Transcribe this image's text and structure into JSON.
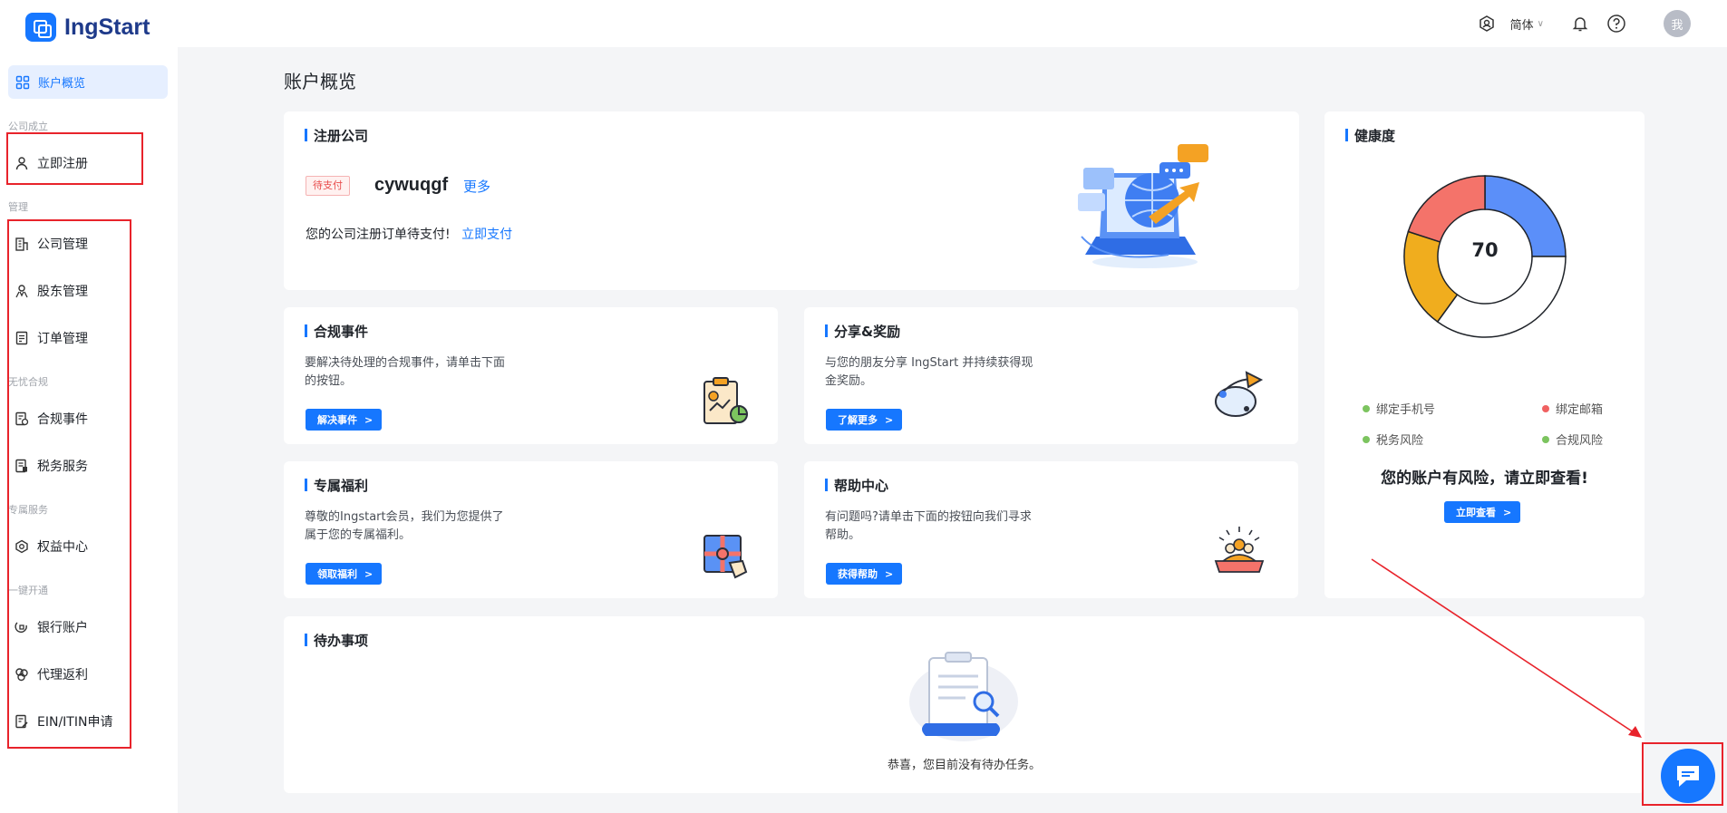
{
  "app": {
    "name": "IngStart"
  },
  "header": {
    "language": "简体",
    "avatar_text": "我"
  },
  "sidebar": {
    "active_item": "账户概览",
    "groups": {
      "company_setup": "公司成立",
      "management": "管理",
      "compliance": "无忧合规",
      "exclusive": "专属服务",
      "quick_open": "一键开通"
    },
    "items": {
      "register": "立即注册",
      "company_mgmt": "公司管理",
      "shareholder_mgmt": "股东管理",
      "order_mgmt": "订单管理",
      "compliance_events": "合规事件",
      "tax_services": "税务服务",
      "benefits_center": "权益中心",
      "bank_account": "银行账户",
      "agent_rebate": "代理返利",
      "ein_itin": "EIN/ITIN申请"
    }
  },
  "main": {
    "page_title": "账户概览",
    "register_card": {
      "title": "注册公司",
      "status": "待支付",
      "company_name": "cywuqgf",
      "more_link": "更多",
      "message": "您的公司注册订单待支付!",
      "pay_link": "立即支付"
    },
    "compliance_card": {
      "title": "合规事件",
      "desc": "要解决待处理的合规事件，请单击下面的按钮。",
      "button": "解决事件"
    },
    "share_card": {
      "title": "分享&奖励",
      "desc": "与您的朋友分享 IngStart 并持续获得现金奖励。",
      "button": "了解更多"
    },
    "benefits_card": {
      "title": "专属福利",
      "desc": "尊敬的Ingstart会员，我们为您提供了属于您的专属福利。",
      "button": "领取福利"
    },
    "help_card": {
      "title": "帮助中心",
      "desc": "有问题吗?请单击下面的按钮向我们寻求帮助。",
      "button": "获得帮助"
    },
    "health_card": {
      "title": "健康度",
      "score": "70",
      "segments": [
        {
          "name": "绑定手机号",
          "share": 0.25,
          "color": "#5b8ff9"
        },
        {
          "name": "合规风险",
          "share": 0.35,
          "color": "#ffffff"
        },
        {
          "name": "税务风险",
          "share": 0.2,
          "color": "#f0ad1e"
        },
        {
          "name": "绑定邮箱",
          "share": 0.2,
          "color": "#f4736a"
        }
      ],
      "legend": {
        "phone": "绑定手机号",
        "email": "绑定邮箱",
        "tax": "税务风险",
        "compliance": "合规风险"
      },
      "status_colors": {
        "ok": "#7cc45f",
        "bad": "#f06161"
      },
      "risk_message": "您的账户有风险，请立即查看!",
      "button": "立即查看"
    },
    "todo_card": {
      "title": "待办事项",
      "empty_text": "恭喜，您目前没有待办任务。"
    }
  },
  "colors": {
    "primary": "#1677ff",
    "annotation": "#e8232b"
  }
}
